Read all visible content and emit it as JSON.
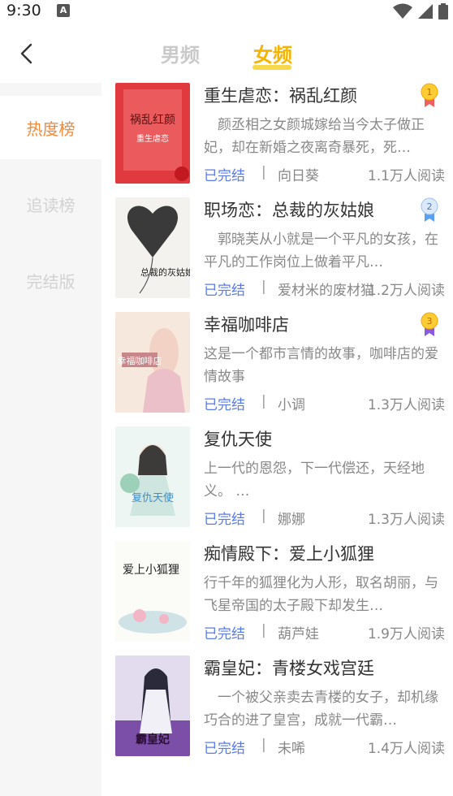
{
  "status_bar": {
    "time": "9:30",
    "notif_letter": "A"
  },
  "header": {
    "tabs": [
      {
        "label": "男频",
        "active": false
      },
      {
        "label": "女频",
        "active": true
      }
    ]
  },
  "sidebar": {
    "items": [
      {
        "label": "热度榜",
        "active": true
      },
      {
        "label": "追读榜",
        "active": false
      },
      {
        "label": "完结版",
        "active": false
      }
    ]
  },
  "books": [
    {
      "title": "重生虐恋：祸乱红颜",
      "desc": "　颜丞相之女颜城嫁给当今太子做正妃，却在新婚之夜离奇暴死，死…",
      "status": "已完结",
      "author": "向日葵",
      "reads": "1.1万人阅读",
      "rank": "1"
    },
    {
      "title": "职场恋：总裁的灰姑娘",
      "desc": "　郭晓芙从小就是一个平凡的女孩，在平凡的工作岗位上做着平凡…",
      "status": "已完结",
      "author": "爱材米的废材猫",
      "reads": "1.2万人阅读",
      "rank": "2"
    },
    {
      "title": "幸福咖啡店",
      "desc": "这是一个都市言情的故事，咖啡店的爱情故事",
      "status": "已完结",
      "author": "小调",
      "reads": "1.3万人阅读",
      "rank": "3"
    },
    {
      "title": "复仇天使",
      "desc": "上一代的恩怨，下一代偿还，天经地义。 …",
      "status": "已完结",
      "author": "娜娜",
      "reads": "1.3万人阅读",
      "rank": ""
    },
    {
      "title": "痴情殿下：爱上小狐狸",
      "desc": "行千年的狐狸化为人形，取名胡丽，与飞星帝国的太子殿下却发生…",
      "status": "已完结",
      "author": "葫芦娃",
      "reads": "1.9万人阅读",
      "rank": ""
    },
    {
      "title": "霸皇妃：青楼女戏宫廷",
      "desc": "　一个被父亲卖去青楼的女子，却机缘巧合的进了皇宫，成就一代霸…",
      "status": "已完结",
      "author": "未唏",
      "reads": "1.4万人阅读",
      "rank": ""
    }
  ],
  "covers": [
    {
      "text": "祸乱红颜",
      "sub": "重生虐恋"
    },
    {
      "text": "总裁的灰姑娘",
      "sub": ""
    },
    {
      "text": "幸福咖啡店",
      "sub": ""
    },
    {
      "text": "复仇天使",
      "sub": ""
    },
    {
      "text": "爱上小狐狸",
      "sub": ""
    },
    {
      "text": "霸皇妃",
      "sub": ""
    }
  ],
  "colors": {
    "accent": "#f5b400",
    "sidebar_active": "#f28a3c",
    "status_link": "#5b7be8"
  }
}
